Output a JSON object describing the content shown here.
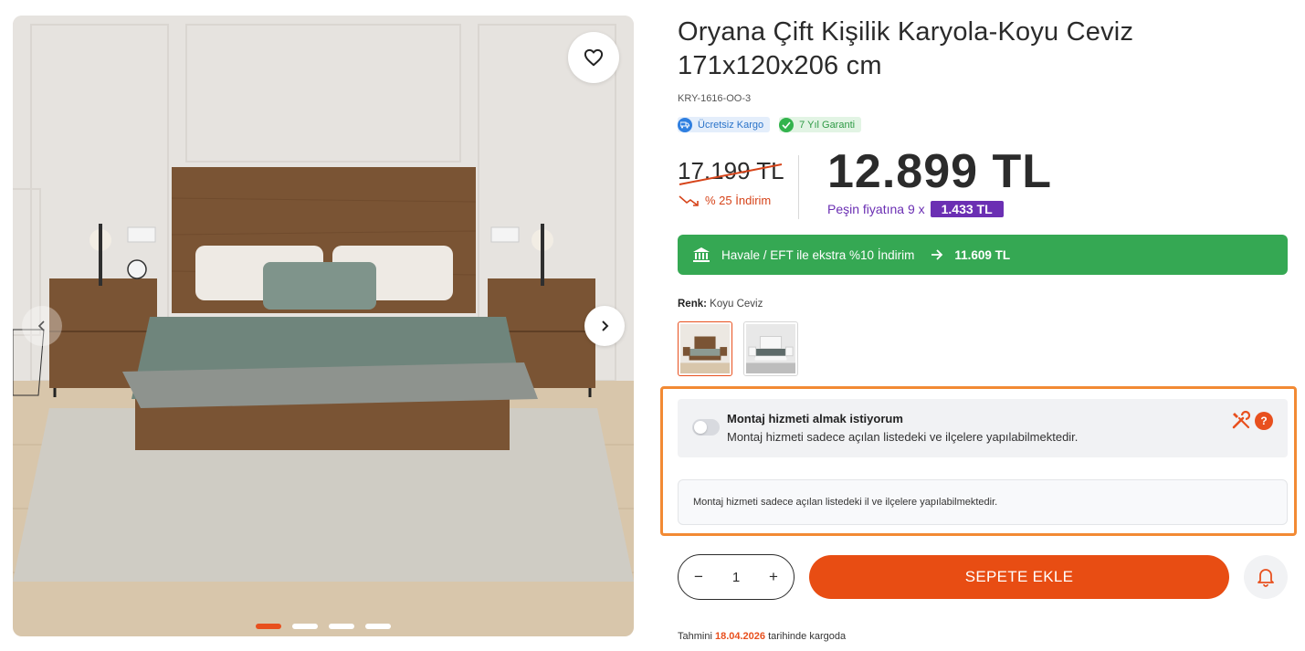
{
  "product": {
    "title": "Oryana Çift Kişilik Karyola-Koyu Ceviz 171x120x206 cm",
    "sku": "KRY-1616-OO-3"
  },
  "badges": [
    {
      "label": "Ücretsiz Kargo",
      "icon": "truck-icon",
      "color": "#2f7fe0"
    },
    {
      "label": "7 Yıl Garanti",
      "icon": "check-icon",
      "color": "#33b34d"
    }
  ],
  "pricing": {
    "old_price": "17.199 TL",
    "discount_label": "% 25 İndirim",
    "new_price": "12.899 TL",
    "installment_prefix": "Peşin fiyatına 9 x",
    "installment_amount": "1.433 TL"
  },
  "eft": {
    "label": "Havale / EFT ile ekstra %10 İndirim",
    "amount": "11.609  TL",
    "color": "#35a853"
  },
  "color": {
    "label_key": "Renk:",
    "label_value": "Koyu Ceviz",
    "options": [
      "Koyu Ceviz",
      "Beyaz"
    ],
    "selected_index": 0
  },
  "assembly": {
    "title": "Montaj hizmeti almak istiyorum",
    "description": "Montaj hizmeti sadece açılan listedeki ve ilçelere yapılabilmektedir.",
    "help_glyph": "?",
    "enabled": false,
    "notice": "Montaj hizmeti sadece açılan listedeki il ve ilçelere yapılabilmektedir."
  },
  "cart": {
    "minus": "−",
    "quantity": "1",
    "plus": "+",
    "add_label": "SEPETE EKLE"
  },
  "shipping": {
    "prefix": "Tahmini",
    "date": "18.04.2026",
    "suffix": "tarihinde kargoda"
  },
  "gallery": {
    "slide_count": 4,
    "active_slide": 0
  },
  "colors": {
    "accent": "#e84d13",
    "purple": "#6b2fb3",
    "green": "#35a853",
    "frame": "#f28a34"
  }
}
